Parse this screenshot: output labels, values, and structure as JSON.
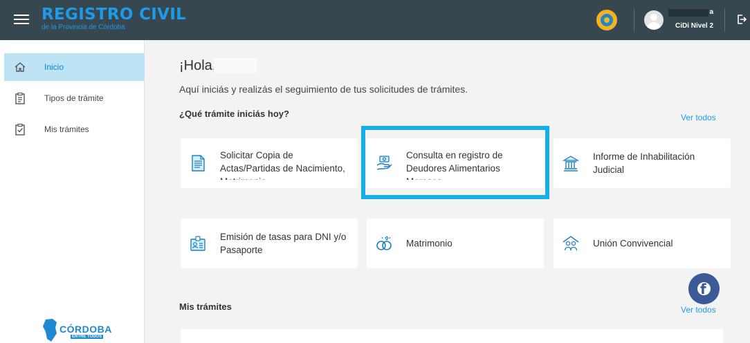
{
  "header": {
    "brand_title": "REGISTRO CIVIL",
    "brand_subtitle": "de la Provincia de Córdoba",
    "user_name_tail": "a",
    "user_level": "CiDi Nivel 2"
  },
  "sidebar": {
    "items": [
      {
        "label": "Inicio",
        "icon": "home-icon",
        "active": true
      },
      {
        "label": "Tipos de trámite",
        "icon": "clipboard-list-icon",
        "active": false
      },
      {
        "label": "Mis trámites",
        "icon": "clipboard-check-icon",
        "active": false
      }
    ],
    "footer_logo_text": "CÓRDOBA",
    "footer_logo_sub": "ENTRE TODOS"
  },
  "main": {
    "greeting": "¡Hola,",
    "intro": "Aquí iniciás y realizás el seguimiento de tus solicitudes de trámites.",
    "tramites_title": "¿Qué trámite iniciás hoy?",
    "ver_todos": "Ver todos",
    "cards": [
      {
        "label": "Solicitar Copia de Actas/Partidas de Nacimiento, Matrimonio",
        "icon": "document-icon"
      },
      {
        "label": "Consulta en registro de Deudores Alimentarios Morosos",
        "icon": "hand-money-icon"
      },
      {
        "label": "Informe de Inhabilitación Judicial",
        "icon": "courthouse-icon"
      },
      {
        "label": "Emisión de tasas para DNI y/o Pasaporte",
        "icon": "id-card-icon"
      },
      {
        "label": "Matrimonio",
        "icon": "rings-icon"
      },
      {
        "label": "Unión Convivencial",
        "icon": "house-people-icon"
      }
    ],
    "mis_tramites_title": "Mis trámites",
    "mis_ver_todos": "Ver todos"
  },
  "colors": {
    "header_bg": "#37474f",
    "accent": "#1e9be8",
    "highlight": "#16aee6",
    "sidebar_active": "#bee3f4"
  }
}
